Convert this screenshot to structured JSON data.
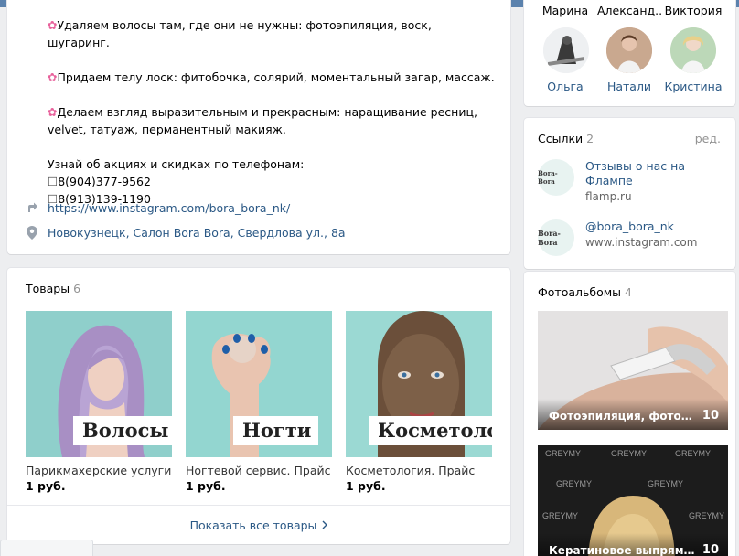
{
  "about": {
    "lines": [
      {
        "icon": "flower",
        "text": "Удаляем волосы там, где они не нужны: фотоэпиляция, воск, шугаринг."
      },
      {
        "icon": "flower",
        "text": "Придаем телу лоск: фитобочка, солярий, моментальный загар, массаж."
      },
      {
        "icon": "flower",
        "text": "Делаем взгляд выразительным и прекрасным: наращивание ресниц, velvet, татуаж, перманентный макияж."
      }
    ],
    "phones_intro": "Узнай об акциях и скидках по телефонам:",
    "phone1": "8(904)377-9562",
    "phone2": "8(913)139-1190",
    "website": "https://www.instagram.com/bora_bora_nk/",
    "address": "Новокузнецк, Салон Bora Bora, Свердлова ул., 8а"
  },
  "goods": {
    "title": "Товары",
    "count": "6",
    "items": [
      {
        "label": "Волосы",
        "title": "Парикмахерские услуги. ...",
        "price": "1 руб."
      },
      {
        "label": "Ногти",
        "title": "Ногтевой сервис. Прайс",
        "price": "1 руб."
      },
      {
        "label": "Косметология",
        "title": "Косметология. Прайс",
        "price": "1 руб."
      }
    ],
    "show_all": "Показать все товары"
  },
  "friends": {
    "row1": [
      "Марина",
      "Александ...",
      "Виктория"
    ],
    "row2": [
      "Ольга",
      "Натали",
      "Кристина"
    ]
  },
  "links": {
    "title": "Ссылки",
    "count": "2",
    "edit": "ред.",
    "items": [
      {
        "title": "Отзывы о нас на Флампе",
        "url": "flamp.ru",
        "logo": "Bora-Bora"
      },
      {
        "title": "@bora_bora_nk",
        "url": "www.instagram.com",
        "logo": "Bora-Bora"
      }
    ]
  },
  "albums": {
    "title": "Фотоальбомы",
    "count": "4",
    "items": [
      {
        "title": "Фотоэпиляция, фотоомо...",
        "count": "10"
      },
      {
        "title": "Кератиновое выпрямле...",
        "count": "10"
      }
    ]
  },
  "colors": {
    "link": "#2a5885",
    "accent": "#5b82ad",
    "page_bg": "#edeef0"
  }
}
